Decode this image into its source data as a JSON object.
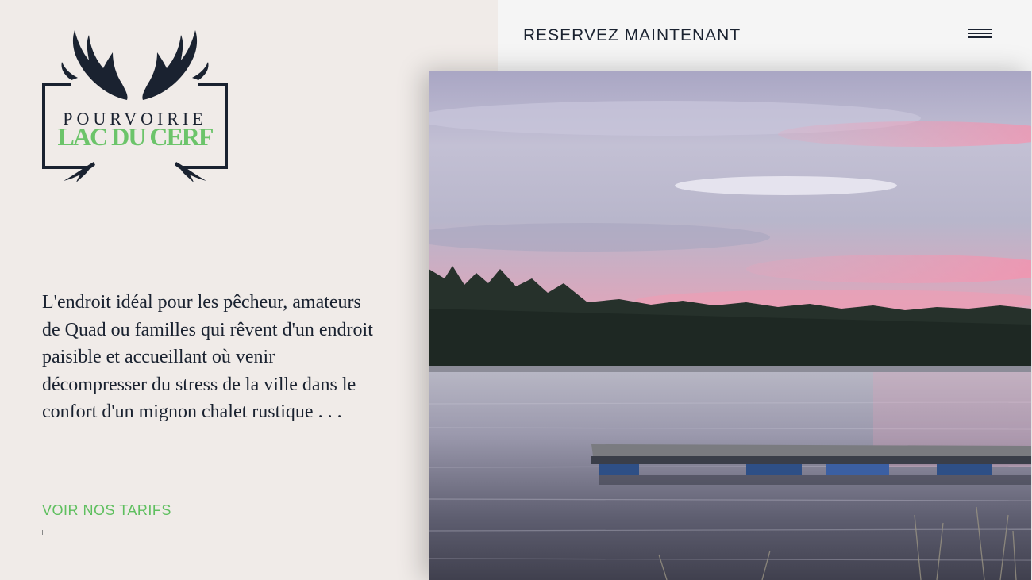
{
  "header": {
    "reserve_label": "RESERVEZ MAINTENANT",
    "menu_icon": "hamburger-menu-icon"
  },
  "logo": {
    "line1": "POURVOIRIE",
    "line2": "LAC DU CERF",
    "icon": "antlers-icon",
    "colors": {
      "dark": "#1a2230",
      "green": "#6cc46a"
    }
  },
  "main": {
    "intro_text": "L'endroit idéal pour les pêcheur, amateurs de Quad ou familles qui rêvent d'un endroit paisible et accueillant où venir décompresser du stress de la ville dans le confort d'un mignon chalet rustique . . .",
    "tarifs_label": "VOIR NOS TARIFS",
    "tick_text": ":"
  },
  "hero_image": {
    "subject": "lake-dock-sunset-photo"
  },
  "colors": {
    "left_background": "#f0ebe8",
    "right_background": "#f5f5f5",
    "text_dark": "#1a2230",
    "accent_green": "#5fbf5f"
  }
}
